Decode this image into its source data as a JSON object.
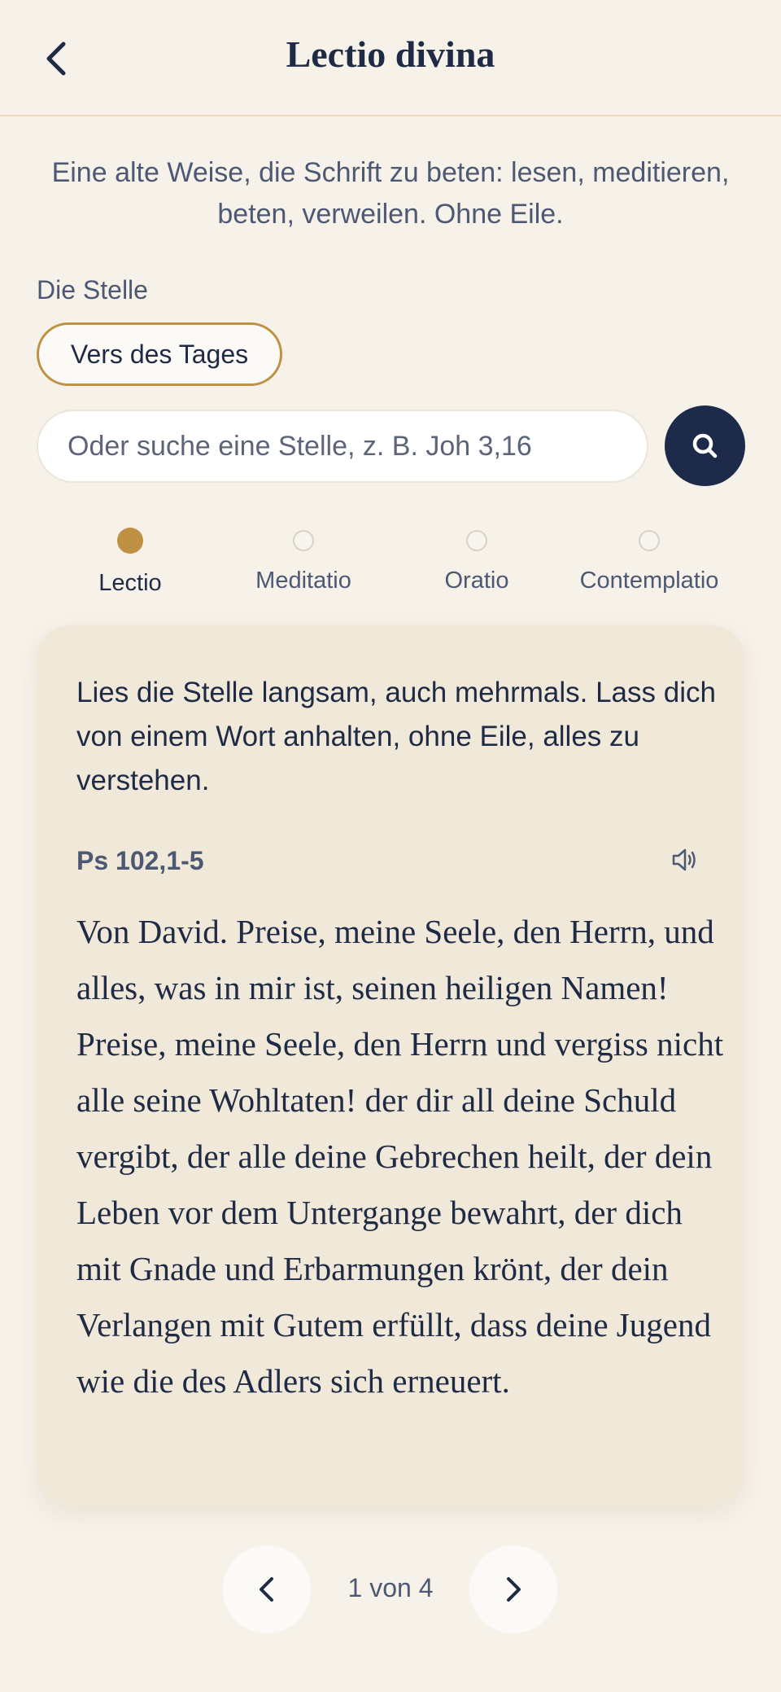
{
  "header": {
    "title": "Lectio divina",
    "back_icon": "chevron-left-icon"
  },
  "intro": "Eine alte Weise, die Schrift zu beten: lesen, meditieren, beten, verweilen. Ohne Eile.",
  "passage_section": {
    "label": "Die Stelle",
    "chip_label": "Vers des Tages",
    "search_placeholder": "Oder suche eine Stelle, z. B. Joh 3,16",
    "search_value": "",
    "search_icon": "search-icon"
  },
  "steps": [
    {
      "label": "Lectio",
      "active": true
    },
    {
      "label": "Meditatio",
      "active": false
    },
    {
      "label": "Oratio",
      "active": false
    },
    {
      "label": "Contemplatio",
      "active": false
    }
  ],
  "card": {
    "instruction": "Lies die Stelle langsam, auch mehrmals. Lass dich von einem Wort anhalten, ohne Eile, alles zu verstehen.",
    "reference": "Ps 102,1-5",
    "speaker_icon": "speaker-icon",
    "text": "Von David. Preise, meine Seele, den Herrn, und alles, was in mir ist, seinen heiligen Namen! Preise, meine Seele, den Herrn und vergiss nicht alle seine Wohltaten! der dir all deine Schuld vergibt, der alle deine Gebrechen heilt, der dein Leben vor dem Untergange bewahrt, der dich mit Gnade und Erbarmungen krönt, der dein Verlangen mit Gutem erfüllt, dass deine Jugend wie die des Adlers sich erneuert."
  },
  "pager": {
    "label": "1 von 4",
    "prev_icon": "chevron-left-icon",
    "next_icon": "chevron-right-icon"
  },
  "colors": {
    "background": "#f6f2ea",
    "navy": "#1e2a4a",
    "gold": "#bf8f42",
    "card": "#f0e8d9"
  }
}
